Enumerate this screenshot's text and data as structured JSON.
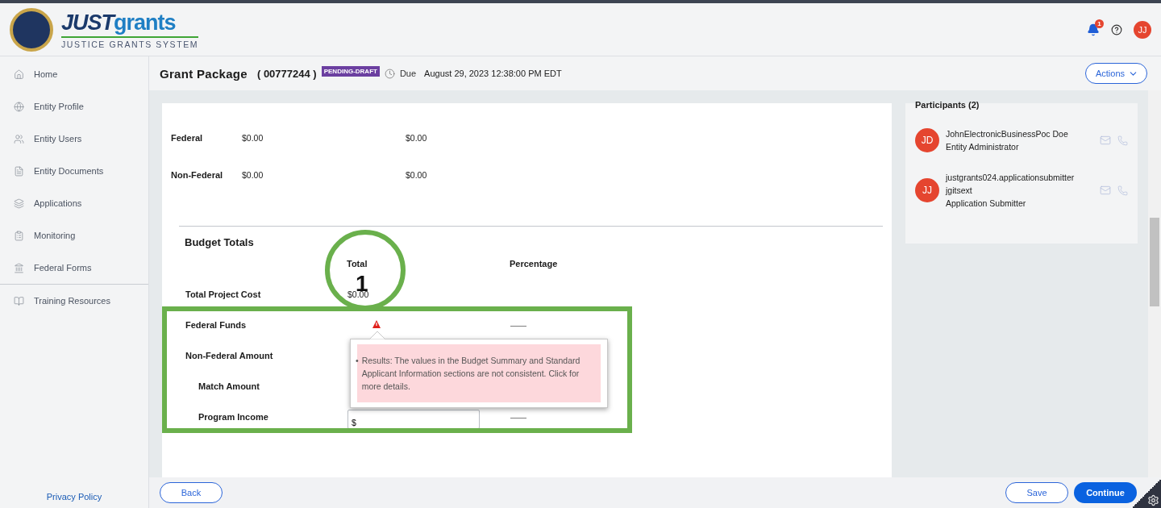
{
  "header": {
    "logo_word_1": "JUST",
    "logo_word_2": "grants",
    "logo_subtitle": "JUSTICE GRANTS SYSTEM",
    "notification_count": "1",
    "user_initials": "JJ"
  },
  "sidebar": {
    "items": [
      {
        "label": "Home"
      },
      {
        "label": "Entity Profile"
      },
      {
        "label": "Entity Users"
      },
      {
        "label": "Entity Documents"
      },
      {
        "label": "Applications"
      },
      {
        "label": "Monitoring"
      },
      {
        "label": "Federal Forms"
      }
    ],
    "secondary_items": [
      {
        "label": "Training Resources"
      }
    ],
    "footer_link": "Privacy Policy"
  },
  "title_bar": {
    "title": "Grant Package",
    "id": "( 00777244 )",
    "status": "PENDING-DRAFT",
    "due_label": "Due",
    "due_date": "August 29, 2023 12:38:00 PM EDT",
    "actions": "Actions"
  },
  "costs": {
    "rows": [
      {
        "label": "Federal",
        "values": [
          "$0.00",
          "$0.00"
        ]
      },
      {
        "label": "Non-Federal",
        "values": [
          "$0.00",
          "$0.00"
        ]
      }
    ]
  },
  "budget_totals": {
    "title": "Budget Totals",
    "columns": [
      "Total",
      "Percentage"
    ],
    "rows": [
      {
        "label": "Total Project Cost",
        "kind": "value",
        "total": "$0.00"
      },
      {
        "label": "Federal Funds",
        "kind": "warning",
        "percentage": "——"
      },
      {
        "label": "Non-Federal Amount",
        "kind": "empty",
        "children": [
          {
            "label": "Match Amount",
            "kind": "empty"
          },
          {
            "label": "Program Income",
            "kind": "input",
            "input_value": "$",
            "percentage": "——"
          }
        ]
      }
    ]
  },
  "tooltip": {
    "bullet": "•",
    "text": "Results: The values in the Budget Summary and Standard Applicant Information sections are not consistent. Click for more details."
  },
  "annotation": {
    "number": "1"
  },
  "participants": {
    "title": "Participants (2)",
    "people": [
      {
        "initials": "JD",
        "lines": [
          "JohnElectronicBusinessPoc Doe",
          "Entity Administrator"
        ]
      },
      {
        "initials": "JJ",
        "lines": [
          "justgrants024.applicationsubmitter",
          "jgitsext",
          "Application Submitter"
        ]
      }
    ]
  },
  "footer": {
    "back": "Back",
    "save": "Save",
    "continue": "Continue"
  }
}
